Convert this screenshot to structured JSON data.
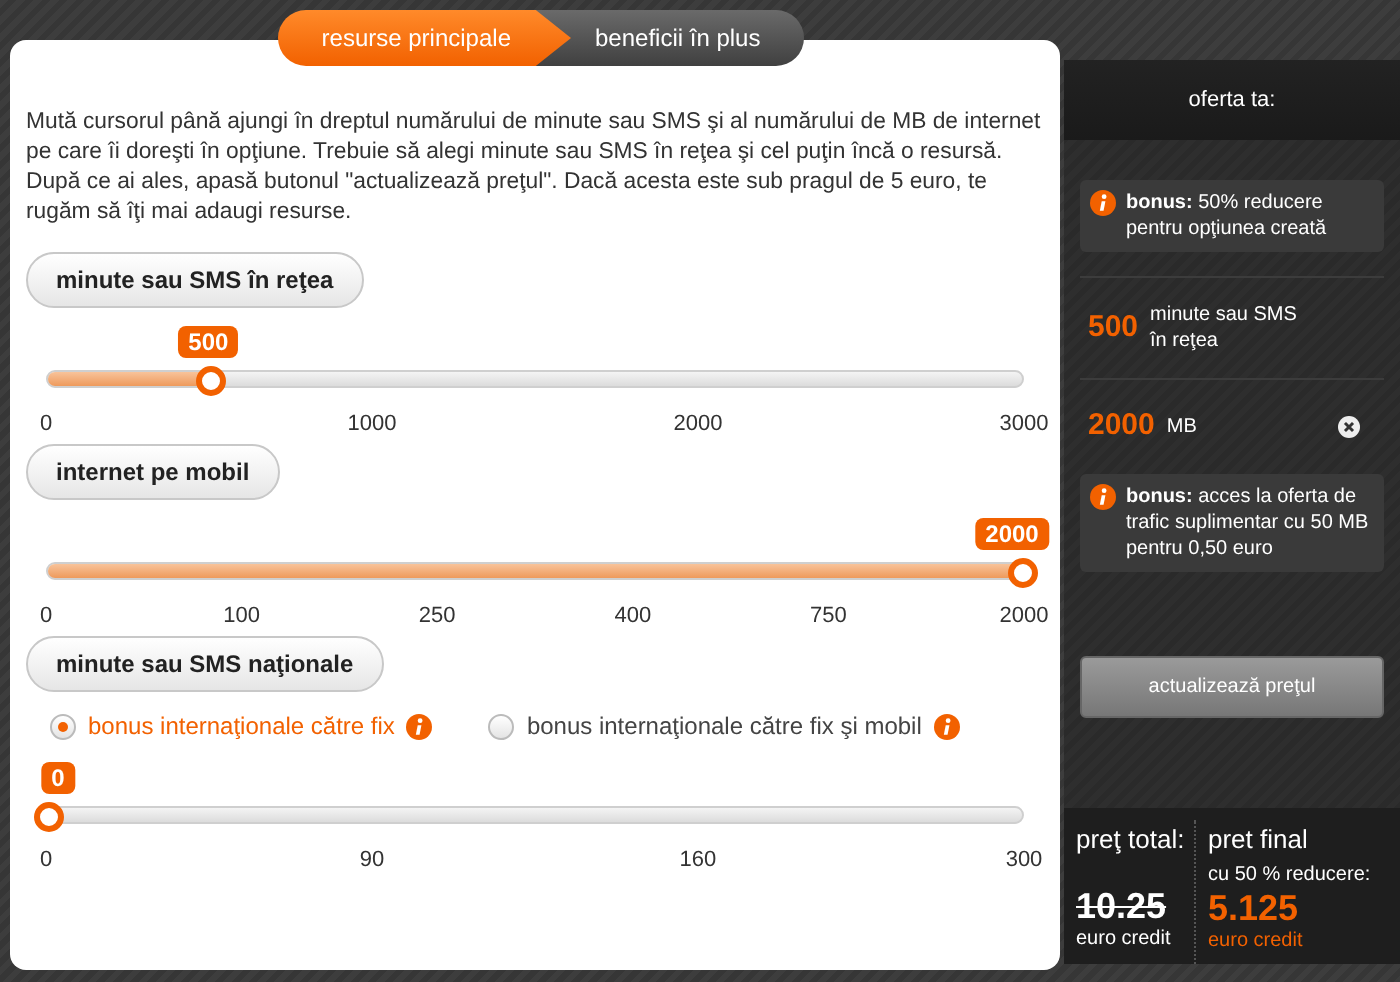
{
  "tabs": [
    {
      "label": "resurse principale",
      "selected": true
    },
    {
      "label": "beneficii în plus",
      "selected": false
    }
  ],
  "intro": "Mută cursorul până ajungi în dreptul numărului de minute sau SMS şi al numărului de MB de internet pe care îi doreşti în opţiune. Trebuie să alegi minute sau SMS în reţea şi cel puţin încă o resursă. După ce ai ales, apasă butonul \"actualizează preţul\". Dacă acesta este sub pragul de 5 euro, te rugăm să îţi mai adaugi resurse.",
  "sections": [
    {
      "title": "minute sau SMS în reţea",
      "slider": {
        "value": "500",
        "level": 0.166,
        "ticks": [
          "0",
          "1000",
          "2000",
          "3000"
        ]
      }
    },
    {
      "title": "internet pe mobil",
      "slider": {
        "value": "2000",
        "level": 1,
        "ticks": [
          "0",
          "100",
          "250",
          "400",
          "750",
          "2000"
        ]
      }
    },
    {
      "title": "minute sau SMS naţionale",
      "options": [
        {
          "label": "bonus internaţionale către fix",
          "selected": true
        },
        {
          "label": "bonus internaţionale către fix şi mobil",
          "selected": false
        }
      ],
      "slider": {
        "value": "0",
        "level": 0,
        "ticks": [
          "0",
          "90",
          "160",
          "300"
        ]
      }
    }
  ],
  "offer": {
    "title": "oferta ta:",
    "items": [
      {
        "kind": "bonus",
        "text": "**bonus:** 50% reducere pentru opţiunea creată"
      },
      {
        "kind": "resource",
        "amount": "500",
        "unit": "minute sau SMS în reţea"
      },
      {
        "kind": "resource",
        "amount": "2000",
        "unit": "MB",
        "removable": true
      },
      {
        "kind": "bonus",
        "text": "**bonus:** acces la oferta de trafic suplimentar cu 50 MB pentru 0,50 euro"
      }
    ],
    "button": "actualizează preţul",
    "total": {
      "label": "preţ total:",
      "value": "10.25",
      "unit": "euro credit"
    },
    "final": {
      "label": "pret final",
      "sublabel": "cu 50 % reducere:",
      "value": "5.125",
      "unit": "euro credit"
    }
  }
}
